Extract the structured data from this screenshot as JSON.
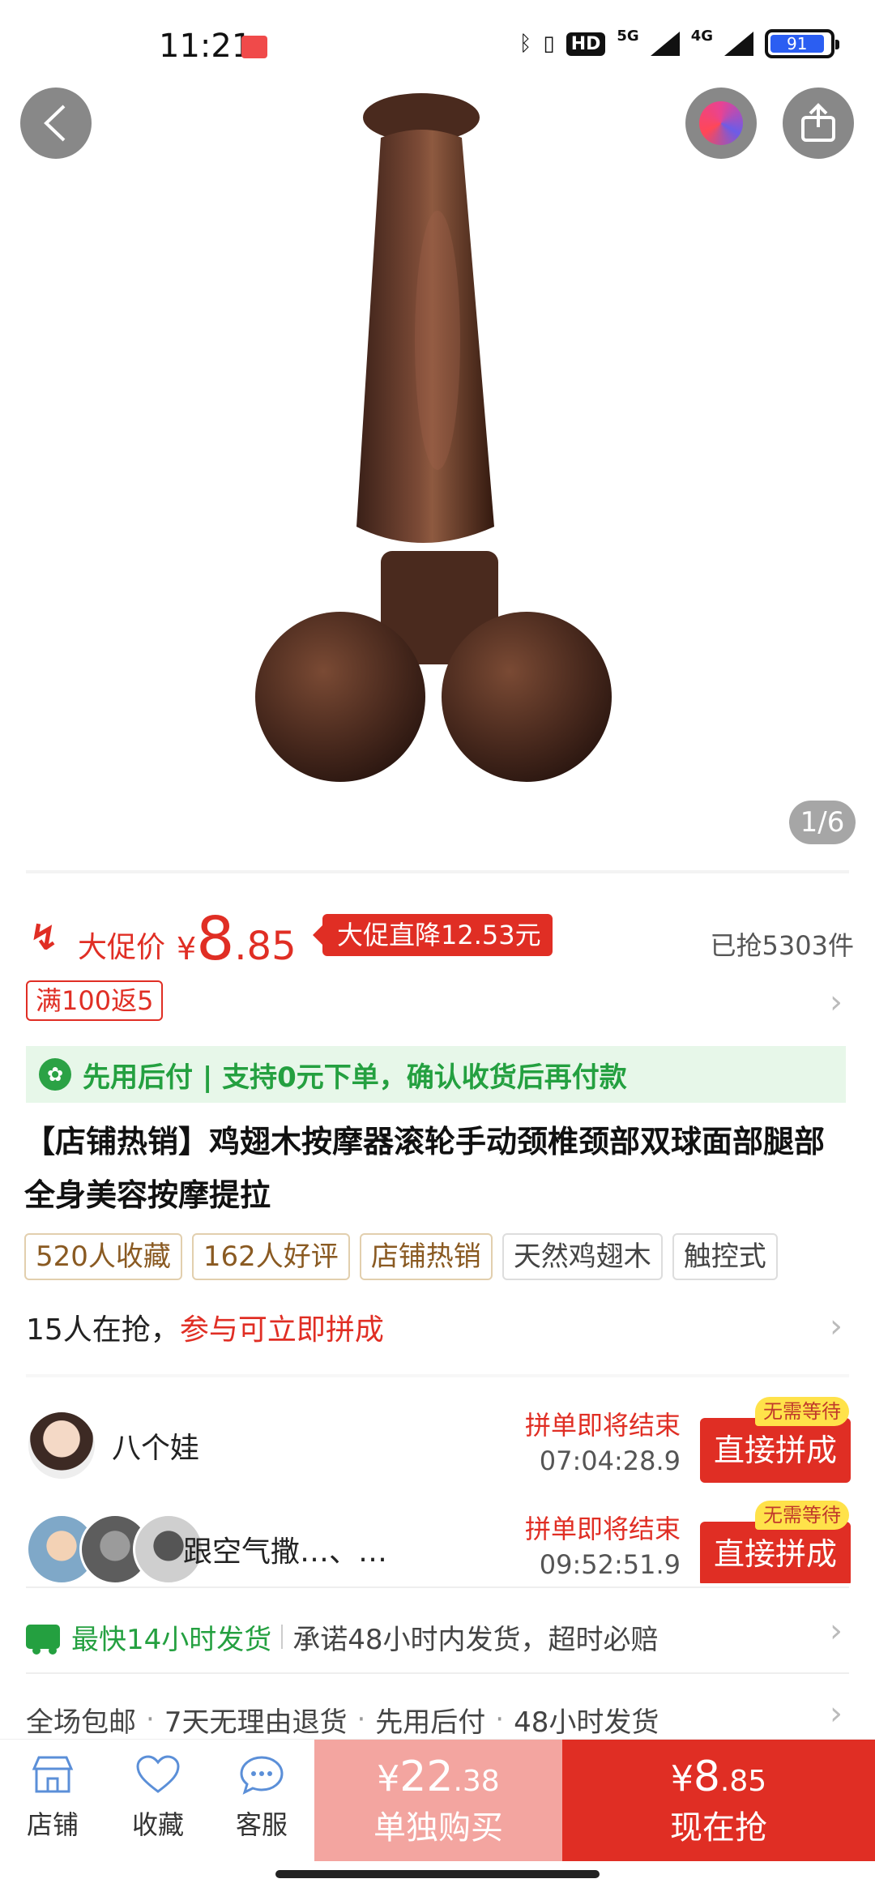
{
  "status_bar": {
    "time": "11:21",
    "hd_label": "HD",
    "net1": "5G",
    "net2": "4G",
    "battery": "91"
  },
  "gallery": {
    "counter": "1/6"
  },
  "price": {
    "label": "大促价",
    "currency": "¥",
    "integer": "8",
    "decimal": ".85",
    "drop_badge": "大促直降12.53元",
    "sold": "已抢5303件"
  },
  "coupon": "满100返5",
  "pay_later": "先用后付 | 支持0元下单，确认收货后再付款",
  "title": "【店铺热销】鸡翅木按摩器滚轮手动颈椎颈部双球面部腿部全身美容按摩提拉",
  "tags": [
    "520人收藏",
    "162人好评",
    "店铺热销",
    "天然鸡翅木",
    "触控式"
  ],
  "group": {
    "count_text": "15人在抢，",
    "cta_text": "参与可立即拼成",
    "items": [
      {
        "name": "八个娃",
        "ending_label": "拼单即将结束",
        "countdown": "07:04:28.9",
        "badge": "无需等待",
        "button": "直接拼成"
      },
      {
        "name": "跟空气撒…、…",
        "ending_label": "拼单即将结束",
        "countdown": "09:52:51.9",
        "badge": "无需等待",
        "button": "直接拼成"
      }
    ]
  },
  "shipping": {
    "highlight": "最快14小时发货",
    "promise": "承诺48小时内发货，超时必赔"
  },
  "services": [
    "全场包邮",
    "7天无理由退货",
    "先用后付",
    "48小时发货"
  ],
  "bottom_bar": {
    "store": "店铺",
    "favorite": "收藏",
    "service": "客服",
    "alone_currency": "¥",
    "alone_int": "22",
    "alone_dec": ".38",
    "alone_label": "单独购买",
    "now_currency": "¥",
    "now_int": "8",
    "now_dec": ".85",
    "now_label": "现在抢"
  },
  "colors": {
    "accent_red": "#e02e24",
    "green": "#24a040",
    "alone_pink": "#f3a5a0"
  }
}
